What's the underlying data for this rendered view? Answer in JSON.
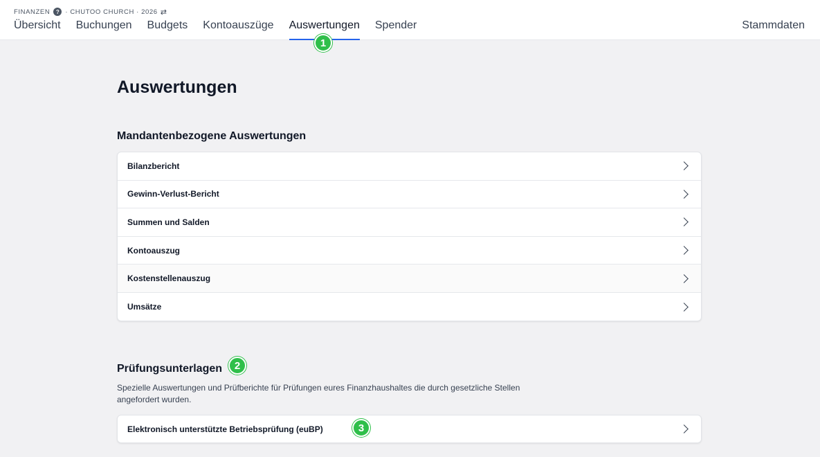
{
  "header": {
    "breadcrumb": {
      "app": "FINANZEN",
      "help_icon": "?",
      "context": "· CHUTOO CHURCH · 2026",
      "swap_icon": "⇄"
    },
    "tabs": [
      {
        "label": "Übersicht",
        "active": false
      },
      {
        "label": "Buchungen",
        "active": false
      },
      {
        "label": "Budgets",
        "active": false
      },
      {
        "label": "Kontoauszüge",
        "active": false
      },
      {
        "label": "Auswertungen",
        "active": true
      },
      {
        "label": "Spender",
        "active": false
      }
    ],
    "right_link": "Stammdaten"
  },
  "page": {
    "title": "Auswertungen"
  },
  "sections": {
    "mandant": {
      "title": "Mandantenbezogene Auswertungen",
      "items": [
        {
          "label": "Bilanzbericht"
        },
        {
          "label": "Gewinn-Verlust-Bericht"
        },
        {
          "label": "Summen und Salden"
        },
        {
          "label": "Kontoauszug"
        },
        {
          "label": "Kostenstellenauszug"
        },
        {
          "label": "Umsätze"
        }
      ]
    },
    "pruefung": {
      "title": "Prüfungsunterlagen",
      "description": "Spezielle Auswertungen und Prüfberichte für Prüfungen eures Finanzhaushaltes die durch gesetzliche Stellen angefordert wurden.",
      "items": [
        {
          "label": "Elektronisch unterstützte Betriebsprüfung (euBP)"
        }
      ]
    }
  },
  "annotations": {
    "badge_1": "1",
    "badge_2": "2",
    "badge_3": "3",
    "badge_color": "#2fbf4a"
  },
  "colors": {
    "accent": "#2563eb",
    "background": "#f1f1f3"
  },
  "icons": {
    "help": "question-circle-icon",
    "swap": "swap-arrows-icon",
    "row": "chevron-right-icon"
  }
}
